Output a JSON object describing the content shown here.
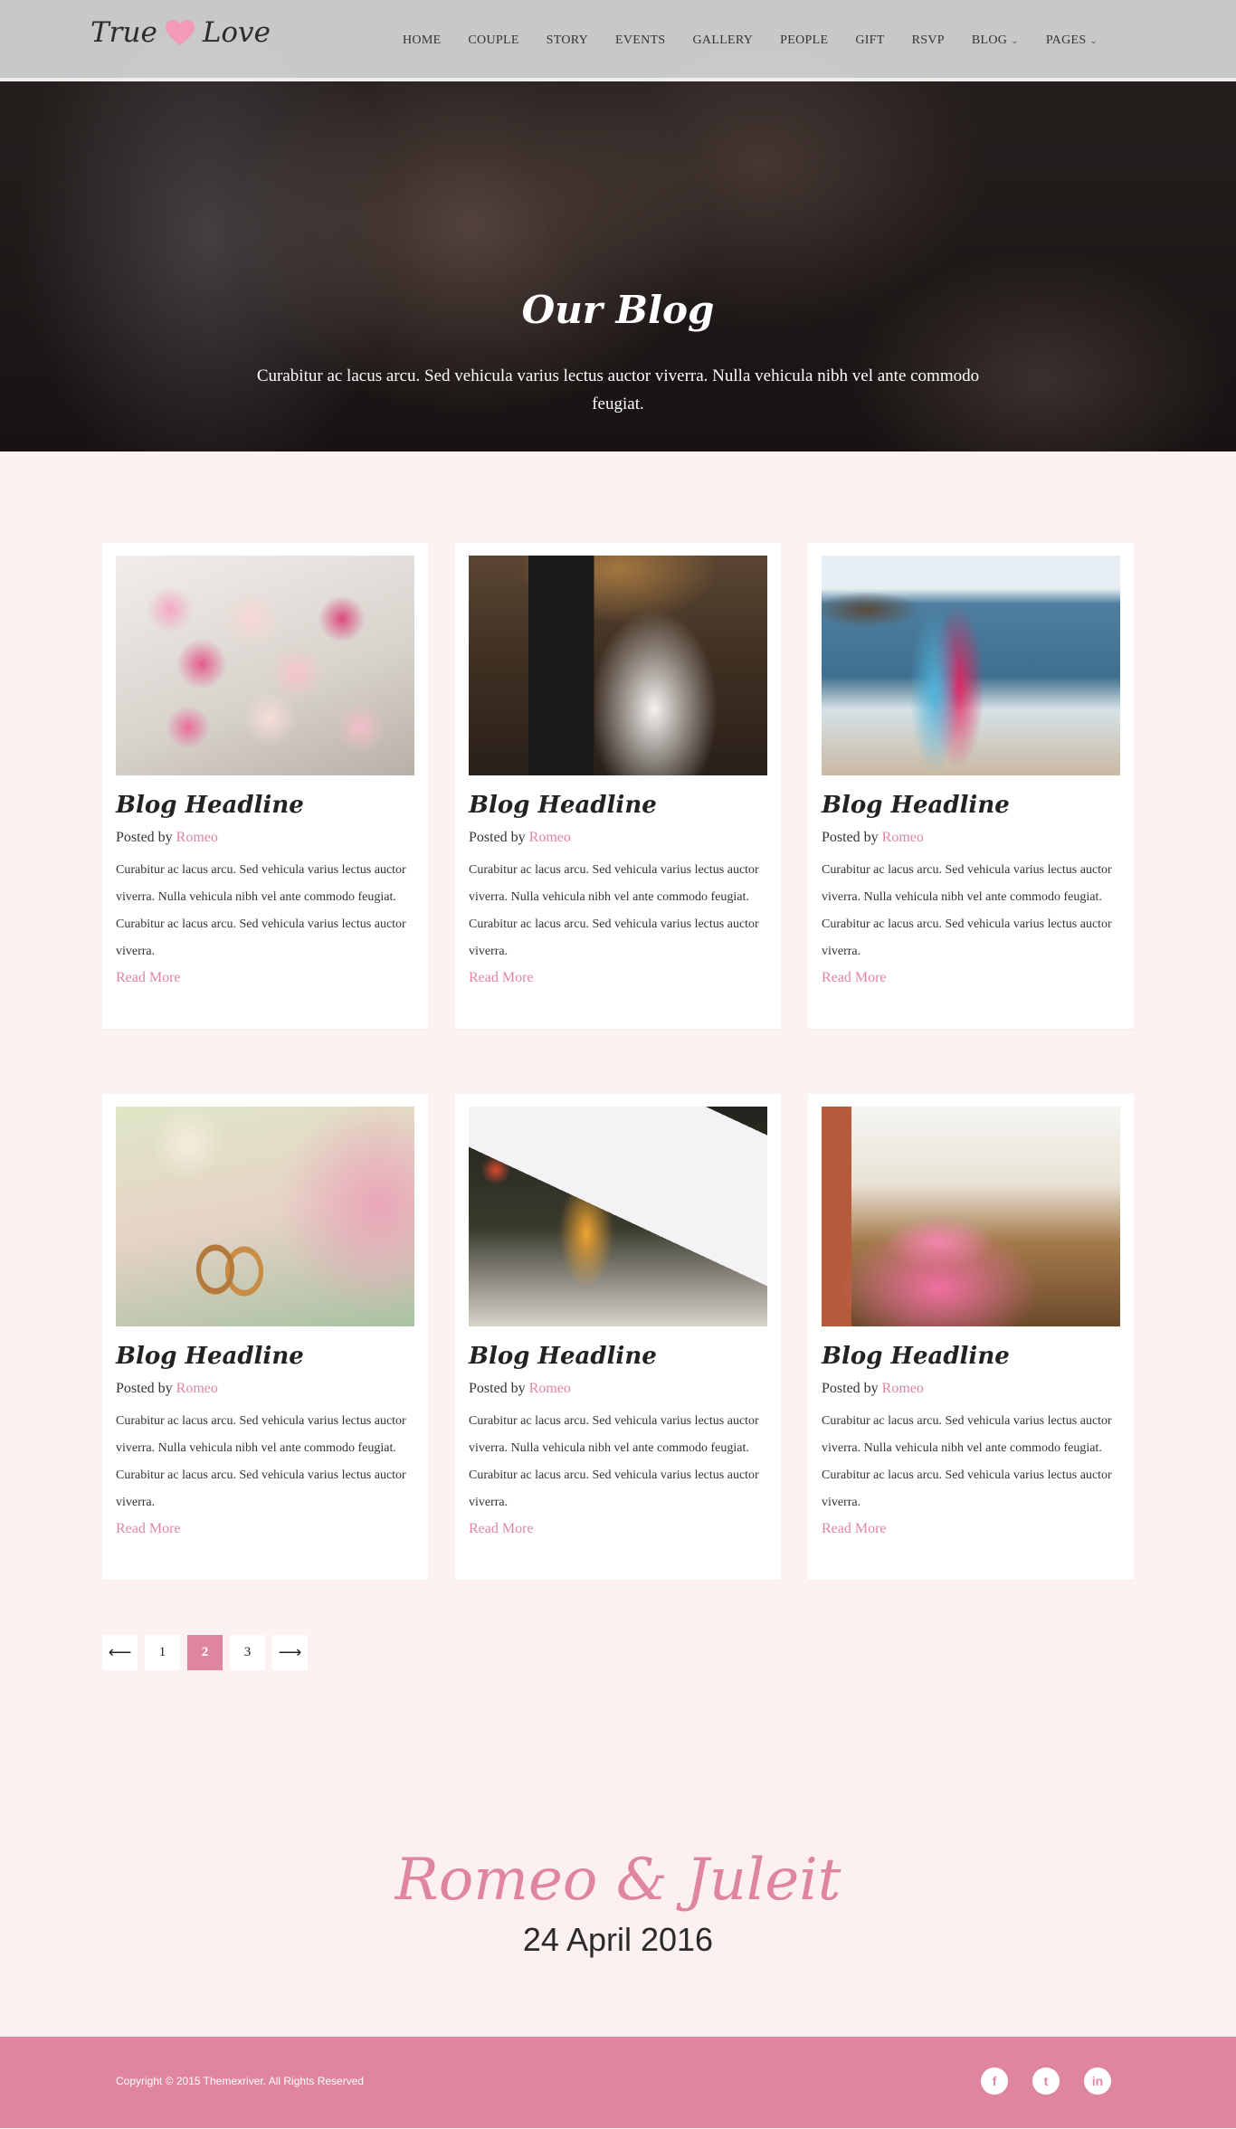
{
  "header": {
    "logo": {
      "word1": "True",
      "word2": "Love"
    },
    "nav": [
      {
        "label": "HOME"
      },
      {
        "label": "COUPLE"
      },
      {
        "label": "STORY"
      },
      {
        "label": "EVENTS"
      },
      {
        "label": "GALLERY"
      },
      {
        "label": "PEOPLE"
      },
      {
        "label": "GIFT"
      },
      {
        "label": "RSVP"
      },
      {
        "label": "BLOG",
        "dropdown": true
      },
      {
        "label": "PAGES",
        "dropdown": true
      }
    ]
  },
  "hero": {
    "title": "Our Blog",
    "subtitle": "Curabitur ac lacus arcu. Sed vehicula varius lectus auctor viverra. Nulla vehicula nibh vel ante commodo feugiat."
  },
  "posts": [
    {
      "image": "bouquet-photo",
      "title": "Blog Headline",
      "posted_by": "Posted by",
      "author": "Romeo",
      "excerpt": "Curabitur ac lacus arcu. Sed vehicula varius lectus auctor viverra. Nulla vehicula nibh vel ante commodo feugiat. Curabitur ac lacus arcu. Sed vehicula varius lectus auctor viverra.",
      "read_more": "Read More"
    },
    {
      "image": "couple-dancing-photo",
      "title": "Blog Headline",
      "posted_by": "Posted by",
      "author": "Romeo",
      "excerpt": "Curabitur ac lacus arcu. Sed vehicula varius lectus auctor viverra. Nulla vehicula nibh vel ante commodo feugiat. Curabitur ac lacus arcu. Sed vehicula varius lectus auctor viverra.",
      "read_more": "Read More"
    },
    {
      "image": "beach-couple-photo",
      "title": "Blog Headline",
      "posted_by": "Posted by",
      "author": "Romeo",
      "excerpt": "Curabitur ac lacus arcu. Sed vehicula varius lectus auctor viverra. Nulla vehicula nibh vel ante commodo feugiat. Curabitur ac lacus arcu. Sed vehicula varius lectus auctor viverra.",
      "read_more": "Read More"
    },
    {
      "image": "wedding-rings-photo",
      "title": "Blog Headline",
      "posted_by": "Posted by",
      "author": "Romeo",
      "excerpt": "Curabitur ac lacus arcu. Sed vehicula varius lectus auctor viverra. Nulla vehicula nibh vel ante commodo feugiat. Curabitur ac lacus arcu. Sed vehicula varius lectus auctor viverra.",
      "read_more": "Read More"
    },
    {
      "image": "welcome-card-photo",
      "title": "Blog Headline",
      "posted_by": "Posted by",
      "author": "Romeo",
      "excerpt": "Curabitur ac lacus arcu. Sed vehicula varius lectus auctor viverra. Nulla vehicula nibh vel ante commodo feugiat. Curabitur ac lacus arcu. Sed vehicula varius lectus auctor viverra.",
      "read_more": "Read More"
    },
    {
      "image": "pink-dress-photo",
      "title": "Blog Headline",
      "posted_by": "Posted by",
      "author": "Romeo",
      "excerpt": "Curabitur ac lacus arcu. Sed vehicula varius lectus auctor viverra. Nulla vehicula nibh vel ante commodo feugiat. Curabitur ac lacus arcu. Sed vehicula varius lectus auctor viverra.",
      "read_more": "Read More"
    }
  ],
  "pagination": {
    "prev_icon": "arrow-left-icon",
    "pages": [
      "1",
      "2",
      "3"
    ],
    "current": "2",
    "next_icon": "arrow-right-icon"
  },
  "couple": {
    "names": "Romeo & Juleit",
    "date": "24 April 2016"
  },
  "footer": {
    "copyright": "Copyright © 2015 Themexriver. All Rights Reserved",
    "socials": [
      {
        "icon": "facebook-icon",
        "glyph": "f"
      },
      {
        "icon": "twitter-icon",
        "glyph": "t"
      },
      {
        "icon": "linkedin-icon",
        "glyph": "in"
      }
    ]
  },
  "colors": {
    "accent": "#e0859f",
    "page_bg": "#fdf2f2",
    "footer_bg": "#e0859f"
  }
}
